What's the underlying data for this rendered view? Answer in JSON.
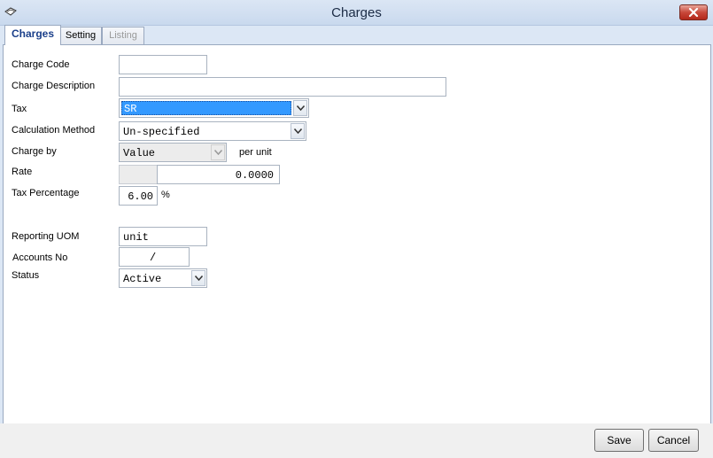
{
  "window": {
    "title": "Charges",
    "close_glyph": "✕"
  },
  "tabs": [
    {
      "label": "Charges",
      "state": "active"
    },
    {
      "label": "Setting",
      "state": "normal"
    },
    {
      "label": "Listing",
      "state": "disabled"
    }
  ],
  "form": {
    "charge_code": {
      "label": "Charge Code",
      "value": ""
    },
    "charge_description": {
      "label": "Charge Description",
      "value": ""
    },
    "tax": {
      "label": "Tax",
      "value": "SR"
    },
    "calculation_method": {
      "label": "Calculation Method",
      "value": "Un-specified"
    },
    "charge_by": {
      "label": "Charge by",
      "value": "Value",
      "suffix": "per unit"
    },
    "rate": {
      "label": "Rate",
      "value": "0.0000"
    },
    "tax_percentage": {
      "label": "Tax Percentage",
      "value": "6.00",
      "suffix": "%"
    },
    "reporting_uom": {
      "label": "Reporting UOM",
      "value": "unit"
    },
    "accounts_no": {
      "label": "Accounts No",
      "value": "/"
    },
    "status": {
      "label": "Status",
      "value": "Active"
    }
  },
  "buttons": {
    "save": "Save",
    "cancel": "Cancel"
  },
  "colors": {
    "selection": "#3399ff",
    "accent": "#1a3f8a",
    "close": "#c8483a"
  }
}
